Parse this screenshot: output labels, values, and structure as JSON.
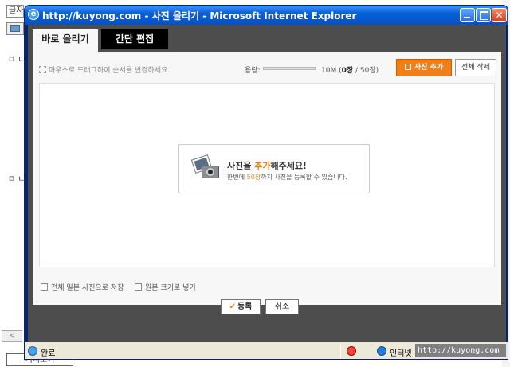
{
  "background": {
    "tag_label": "글자",
    "bullet1": "ㅁ ㄴ",
    "bullet2": "ㅁ ㄴ",
    "scroll_arrow": "<",
    "bottom_button": "미리보기"
  },
  "window": {
    "title": "http://kuyong.com - 사진 올리기 - Microsoft Internet Explorer",
    "ie_icon": "e",
    "minimize_icon": "minimize-icon",
    "maximize_icon": "maximize-icon",
    "close_icon": "close-icon",
    "close_glyph": "✕"
  },
  "tabs": [
    {
      "label": "바로 올리기",
      "active": true
    },
    {
      "label": "간단 편집",
      "active": false
    }
  ],
  "toolbar": {
    "hint": "마우스로 드래그하여 순서를 변경하세요.",
    "capacity_label": "용량:",
    "capacity_size": "10M",
    "capacity_count": "0장",
    "capacity_max": "50장",
    "capacity_fraction": 0,
    "add_label": "사진 추가",
    "delete_all_label": "전체 삭제"
  },
  "prompt": {
    "title_prefix": "사진을 ",
    "title_highlight": "추가",
    "title_suffix": "해주세요!",
    "sub_prefix": "한번에 ",
    "sub_highlight": "50장",
    "sub_suffix": "까지 사진을 등록할 수 있습니다."
  },
  "options": {
    "save_original": "전체 일본 사진으로 저장",
    "original_size": "원본 크기로 넣기"
  },
  "actions": {
    "register_check": "✔",
    "register_label": "등록",
    "cancel_label": "취소"
  },
  "statusbar": {
    "status": "완료",
    "zone": "인터넷",
    "url": "http://kuyong.com"
  },
  "colors": {
    "accent_orange": "#f07f18",
    "panel_dark": "#4d4d4d",
    "titlebar_blue": "#0a5fd8"
  }
}
